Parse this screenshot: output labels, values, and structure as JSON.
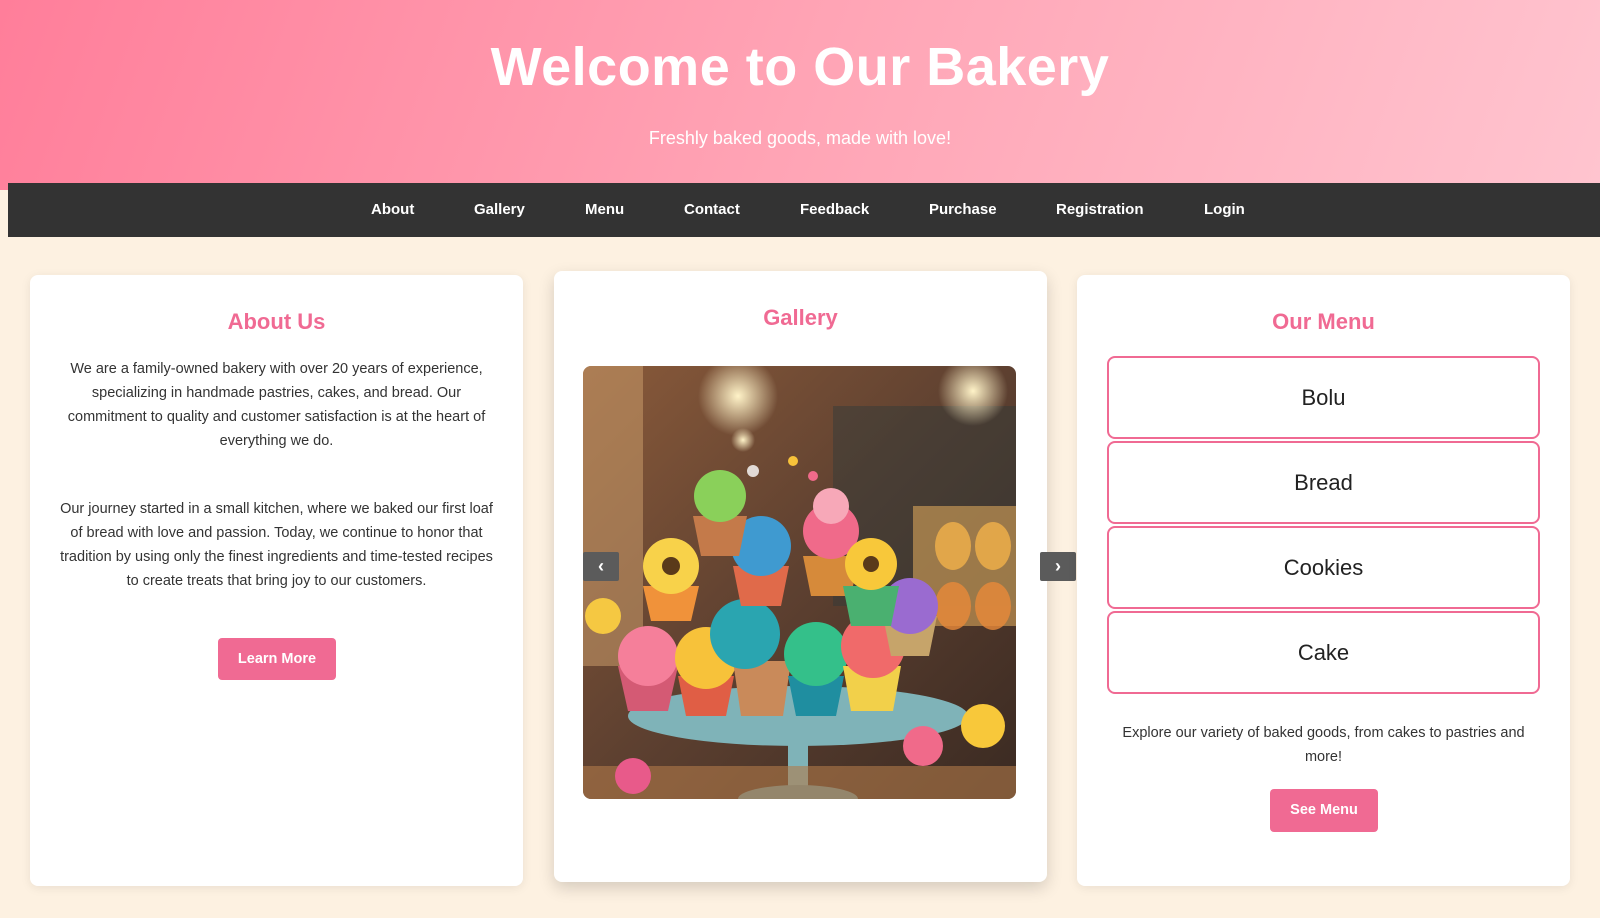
{
  "header": {
    "title": "Welcome to Our Bakery",
    "subtitle": "Freshly baked goods, made with love!"
  },
  "nav": {
    "items": [
      "About",
      "Gallery",
      "Menu",
      "Contact",
      "Feedback",
      "Purchase",
      "Registration",
      "Login"
    ]
  },
  "about": {
    "title": "About Us",
    "paragraph1": "We are a family-owned bakery with over 20 years of experience, specializing in handmade pastries, cakes, and bread. Our commitment to quality and customer satisfaction is at the heart of everything we do.",
    "paragraph2": "Our journey started in a small kitchen, where we baked our first loaf of bread with love and passion. Today, we continue to honor that tradition by using only the finest ingredients and time-tested recipes to create treats that bring joy to our customers.",
    "button": "Learn More"
  },
  "gallery": {
    "title": "Gallery",
    "prev_icon": "‹",
    "next_icon": "›"
  },
  "menu": {
    "title": "Our Menu",
    "items": [
      "Bolu",
      "Bread",
      "Cookies",
      "Cake"
    ],
    "description": "Explore our variety of baked goods, from cakes to pastries and more!",
    "button": "See Menu"
  },
  "colors": {
    "accent": "#f06a93",
    "nav_bg": "#333333",
    "page_bg": "#fdf1e1"
  }
}
